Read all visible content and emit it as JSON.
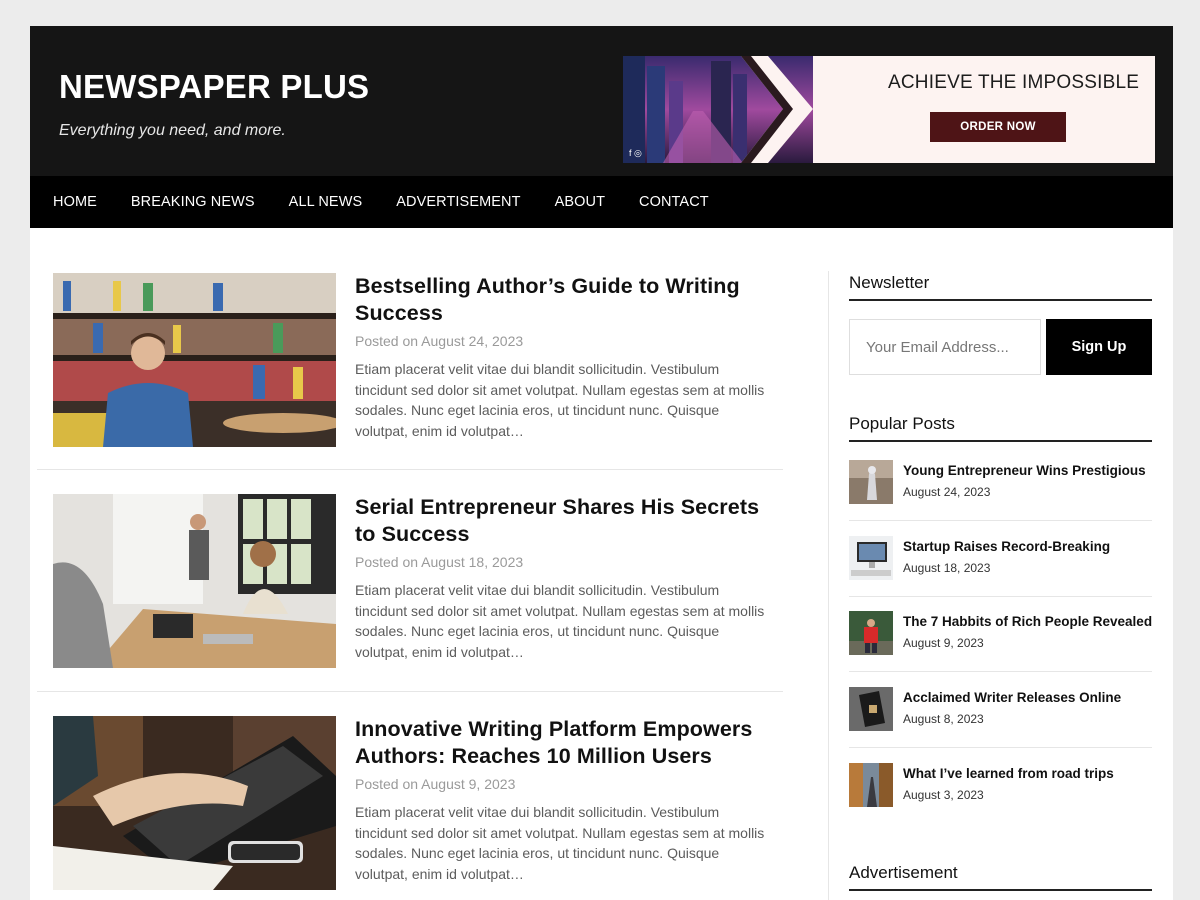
{
  "site": {
    "title": "NEWSPAPER PLUS",
    "tagline": "Everything you need, and more."
  },
  "banner": {
    "headline": "ACHIEVE THE IMPOSSIBLE",
    "button_label": "ORDER NOW",
    "social": "f  ◎"
  },
  "nav": {
    "items": [
      "HOME",
      "BREAKING NEWS",
      "ALL NEWS",
      "ADVERTISEMENT",
      "ABOUT",
      "CONTACT"
    ]
  },
  "posts": [
    {
      "title": "Bestselling Author’s Guide to Writing Success",
      "date": "Posted on August 24, 2023",
      "excerpt": "Etiam placerat velit vitae dui blandit sollicitudin. Vestibulum tincidunt sed dolor sit amet volutpat. Nullam egestas sem at mollis sodales. Nunc eget lacinia eros, ut tincidunt nunc. Quisque volutpat, enim id volutpat…"
    },
    {
      "title": "Serial Entrepreneur Shares His Secrets to Success",
      "date": "Posted on August 18, 2023",
      "excerpt": "Etiam placerat velit vitae dui blandit sollicitudin. Vestibulum tincidunt sed dolor sit amet volutpat. Nullam egestas sem at mollis sodales. Nunc eget lacinia eros, ut tincidunt nunc. Quisque volutpat, enim id volutpat…"
    },
    {
      "title": "Innovative Writing Platform Empowers Authors: Reaches 10 Million Users",
      "date": "Posted on August 9, 2023",
      "excerpt": "Etiam placerat velit vitae dui blandit sollicitudin. Vestibulum tincidunt sed dolor sit amet volutpat. Nullam egestas sem at mollis sodales. Nunc eget lacinia eros, ut tincidunt nunc. Quisque volutpat, enim id volutpat…"
    }
  ],
  "sidebar": {
    "newsletter": {
      "title": "Newsletter",
      "placeholder": "Your Email Address...",
      "button_label": "Sign Up"
    },
    "popular": {
      "title": "Popular Posts",
      "items": [
        {
          "title": "Young Entrepreneur Wins Prestigious",
          "date": "August 24, 2023"
        },
        {
          "title": "Startup Raises Record-Breaking",
          "date": "August 18, 2023"
        },
        {
          "title": "The 7 Habbits of Rich People Revealed",
          "date": "August 9, 2023"
        },
        {
          "title": "Acclaimed Writer Releases Online",
          "date": "August 8, 2023"
        },
        {
          "title": "What I’ve learned from road trips",
          "date": "August 3, 2023"
        }
      ]
    },
    "advertisement": {
      "title": "Advertisement"
    }
  },
  "colors": {
    "header_bg": "#151515",
    "nav_bg": "#000000",
    "banner_bg": "#fdf3f1",
    "banner_button": "#4e1416",
    "page_bg": "#ececec"
  }
}
